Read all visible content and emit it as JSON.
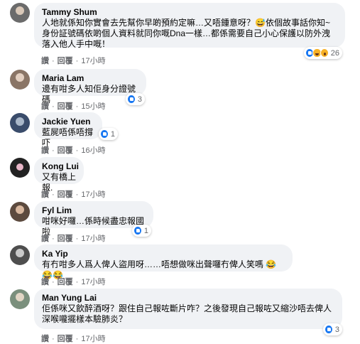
{
  "actions": {
    "like": "讚",
    "reply": "回覆"
  },
  "comments": [
    {
      "name": "Tammy Shum",
      "text": "人地就係知你實會去先幫你早啲預約定嘛…又唔鍾意呀？😅依個故事話你知~身份証號碼依啲個人資料就同你嘅Dna一樣…都係需要自己小心保護以防外洩落入他人手中嘅！",
      "time": "17小時",
      "reactions": {
        "icons": [
          "like-icon",
          "haha-icon",
          "wow-icon"
        ],
        "count": "26"
      },
      "avatar_color": "#6b6b6b"
    },
    {
      "name": "Maria Lam",
      "text": "邊有咁多人知佢身分證號碼",
      "time": "15小時",
      "reactions": {
        "icons": [
          "like-icon"
        ],
        "count": "3"
      },
      "avatar_color": "#8a7566"
    },
    {
      "name": "Jackie Yuen",
      "text": "藍屍唔係唔撐吓",
      "time": "16小時",
      "reactions": {
        "icons": [
          "like-icon"
        ],
        "count": "1"
      },
      "avatar_color": "#3a4c6b"
    },
    {
      "name": "Kong Lui",
      "text": "又有橋上報.",
      "time": "17小時",
      "reactions": null,
      "avatar_color": "#222222"
    },
    {
      "name": "Fyl Lim",
      "text": "咁咪好囉…係時候盡忠報國啦",
      "time": "17小時",
      "reactions": {
        "icons": [
          "like-icon"
        ],
        "count": "1"
      },
      "avatar_color": "#5c4a3e"
    },
    {
      "name": "Ka Yip",
      "text": "有冇咁多人爲人俾人盜用呀……唔想做咪出聲囉冇俾人笑嗎",
      "emojis": [
        "😂",
        "😂",
        "😂"
      ],
      "time": "17小時",
      "reactions": null,
      "avatar_color": "#4e4e4e"
    },
    {
      "name": "Man Yung Lai",
      "text": "佢係咪又飲醉酒呀？跟住自己報咗斷片咋？之後發現自己報咗又縮沙唔去俾人深喉嚨擺樣本驗肺炎？",
      "time": "17小時",
      "reactions": {
        "icons": [
          "like-icon"
        ],
        "count": "3"
      },
      "avatar_color": "#7a8f7c"
    }
  ]
}
